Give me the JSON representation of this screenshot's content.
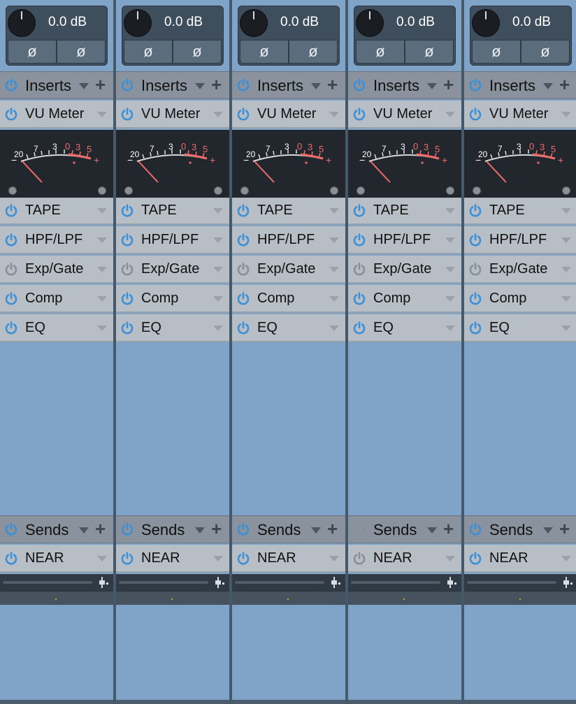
{
  "colors": {
    "power_on": "#3d8fd6",
    "power_off": "#8a8f95",
    "vu_red": "#f06a6a",
    "vu_white": "#ffffff"
  },
  "vu_scale": {
    "m20": "20",
    "m7": "7",
    "m3": "3",
    "z0": "0",
    "p3": "3",
    "p5": "5",
    "minus": "−",
    "plus": "+"
  },
  "channels": [
    {
      "gain": "0.0 dB",
      "phase_left": "ø",
      "phase_right": "ø",
      "inserts_label": "Inserts",
      "inserts_on": true,
      "plugins": [
        {
          "label": "VU Meter",
          "on": true
        },
        {
          "label": "TAPE",
          "on": true
        },
        {
          "label": "HPF/LPF",
          "on": true
        },
        {
          "label": "Exp/Gate",
          "on": false
        },
        {
          "label": "Comp",
          "on": true
        },
        {
          "label": "EQ",
          "on": true
        }
      ],
      "sends_label": "Sends",
      "sends_on": true,
      "send": {
        "label": "NEAR",
        "on": true
      }
    },
    {
      "gain": "0.0 dB",
      "phase_left": "ø",
      "phase_right": "ø",
      "inserts_label": "Inserts",
      "inserts_on": true,
      "plugins": [
        {
          "label": "VU Meter",
          "on": true
        },
        {
          "label": "TAPE",
          "on": true
        },
        {
          "label": "HPF/LPF",
          "on": true
        },
        {
          "label": "Exp/Gate",
          "on": false
        },
        {
          "label": "Comp",
          "on": true
        },
        {
          "label": "EQ",
          "on": true
        }
      ],
      "sends_label": "Sends",
      "sends_on": true,
      "send": {
        "label": "NEAR",
        "on": true
      }
    },
    {
      "gain": "0.0 dB",
      "phase_left": "ø",
      "phase_right": "ø",
      "inserts_label": "Inserts",
      "inserts_on": true,
      "plugins": [
        {
          "label": "VU Meter",
          "on": true
        },
        {
          "label": "TAPE",
          "on": true
        },
        {
          "label": "HPF/LPF",
          "on": true
        },
        {
          "label": "Exp/Gate",
          "on": false
        },
        {
          "label": "Comp",
          "on": true
        },
        {
          "label": "EQ",
          "on": true
        }
      ],
      "sends_label": "Sends",
      "sends_on": true,
      "send": {
        "label": "NEAR",
        "on": true
      }
    },
    {
      "gain": "0.0 dB",
      "phase_left": "ø",
      "phase_right": "ø",
      "inserts_label": "Inserts",
      "inserts_on": true,
      "plugins": [
        {
          "label": "VU Meter",
          "on": true
        },
        {
          "label": "TAPE",
          "on": true
        },
        {
          "label": "HPF/LPF",
          "on": true
        },
        {
          "label": "Exp/Gate",
          "on": false
        },
        {
          "label": "Comp",
          "on": true
        },
        {
          "label": "EQ",
          "on": true
        }
      ],
      "sends_label": "Sends",
      "sends_on": false,
      "send": {
        "label": "NEAR",
        "on": false
      }
    },
    {
      "gain": "0.0 dB",
      "phase_left": "ø",
      "phase_right": "ø",
      "inserts_label": "Inserts",
      "inserts_on": true,
      "plugins": [
        {
          "label": "VU Meter",
          "on": true
        },
        {
          "label": "TAPE",
          "on": true
        },
        {
          "label": "HPF/LPF",
          "on": true
        },
        {
          "label": "Exp/Gate",
          "on": false
        },
        {
          "label": "Comp",
          "on": true
        },
        {
          "label": "EQ",
          "on": true
        }
      ],
      "sends_label": "Sends",
      "sends_on": true,
      "send": {
        "label": "NEAR",
        "on": true
      }
    }
  ]
}
